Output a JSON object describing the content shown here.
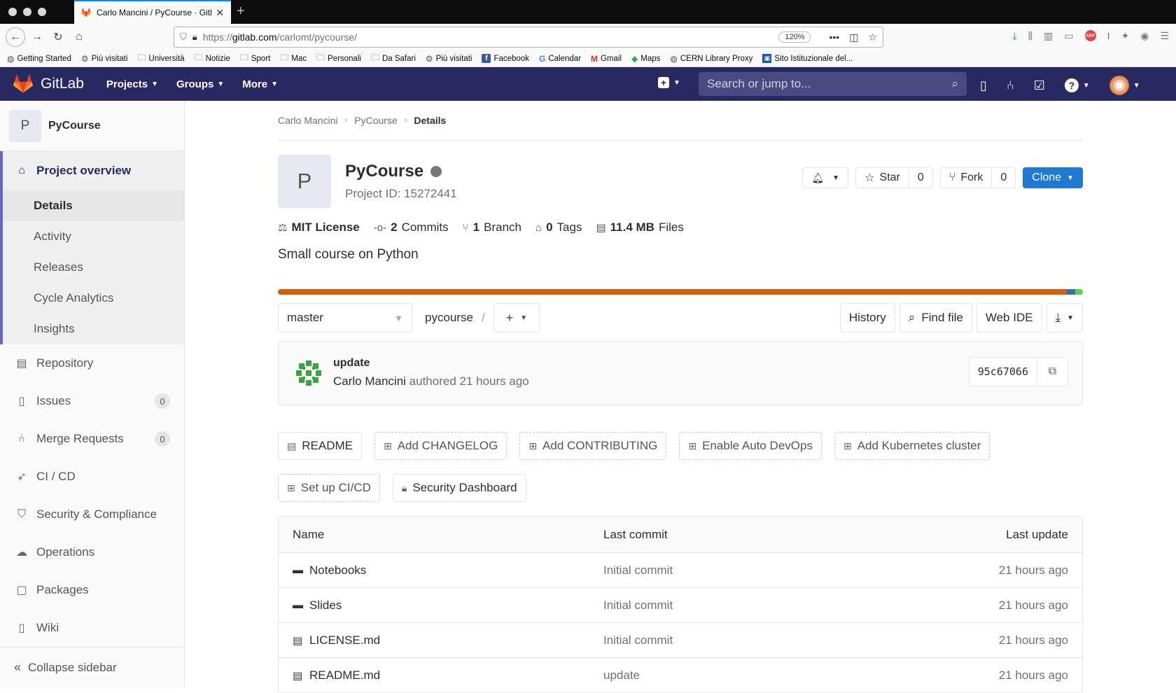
{
  "browser": {
    "tab_title": "Carlo Mancini / PyCourse · GitLab",
    "url_prefix": "https://",
    "url_host": "gitlab.com",
    "url_path": "/carlomt/pycourse/",
    "zoom": "120%",
    "bookmarks": [
      {
        "label": "Getting Started",
        "icon": "globe-icon"
      },
      {
        "label": "Più visitati",
        "icon": "gear-icon"
      },
      {
        "label": "Università",
        "icon": "folder-icon"
      },
      {
        "label": "Notizie",
        "icon": "folder-icon"
      },
      {
        "label": "Sport",
        "icon": "folder-icon"
      },
      {
        "label": "Mac",
        "icon": "folder-icon"
      },
      {
        "label": "Personali",
        "icon": "folder-icon"
      },
      {
        "label": "Da Safari",
        "icon": "folder-icon"
      },
      {
        "label": "Più visitati",
        "icon": "gear-icon"
      },
      {
        "label": "Facebook",
        "icon": "facebook-icon"
      },
      {
        "label": "Calendar",
        "icon": "google-icon"
      },
      {
        "label": "Gmail",
        "icon": "gmail-icon"
      },
      {
        "label": "Maps",
        "icon": "maps-icon"
      },
      {
        "label": "CERN Library Proxy",
        "icon": "globe-icon"
      },
      {
        "label": "Sito Istituzionale del...",
        "icon": "site-icon"
      }
    ]
  },
  "header": {
    "brand": "GitLab",
    "nav": [
      "Projects",
      "Groups",
      "More"
    ],
    "search_placeholder": "Search or jump to..."
  },
  "sidebar": {
    "project_initial": "P",
    "project_name": "PyCourse",
    "overview_label": "Project overview",
    "overview_sub": [
      "Details",
      "Activity",
      "Releases",
      "Cycle Analytics",
      "Insights"
    ],
    "items": [
      {
        "label": "Repository",
        "icon": "doc-icon"
      },
      {
        "label": "Issues",
        "icon": "issues-icon",
        "badge": "0"
      },
      {
        "label": "Merge Requests",
        "icon": "merge-request-icon",
        "badge": "0"
      },
      {
        "label": "CI / CD",
        "icon": "rocket-icon"
      },
      {
        "label": "Security & Compliance",
        "icon": "shield-icon"
      },
      {
        "label": "Operations",
        "icon": "cloud-gear-icon"
      },
      {
        "label": "Packages",
        "icon": "package-icon"
      },
      {
        "label": "Wiki",
        "icon": "book-icon"
      }
    ],
    "collapse_label": "Collapse sidebar"
  },
  "breadcrumb": [
    "Carlo Mancini",
    "PyCourse",
    "Details"
  ],
  "project": {
    "initial": "P",
    "name": "PyCourse",
    "id_text": "Project ID: 15272441",
    "star_label": "Star",
    "star_count": "0",
    "fork_label": "Fork",
    "fork_count": "0",
    "clone_label": "Clone",
    "stats": [
      {
        "icon": "scale-icon",
        "bold": "MIT License",
        "rest": ""
      },
      {
        "icon": "commit-icon",
        "bold": "2",
        "rest": "Commits"
      },
      {
        "icon": "branch-icon",
        "bold": "1",
        "rest": "Branch"
      },
      {
        "icon": "tag-icon",
        "bold": "0",
        "rest": "Tags"
      },
      {
        "icon": "file-icon",
        "bold": "11.4 MB",
        "rest": "Files"
      }
    ],
    "description": "Small course on Python",
    "languages": [
      {
        "share": 98.0,
        "color": "#DA5B0B"
      },
      {
        "share": 1.0,
        "color": "#3572A5"
      },
      {
        "share": 1.0,
        "color": "#5BD14A"
      }
    ]
  },
  "tree": {
    "branch": "master",
    "path": "pycourse",
    "path_sep": "/",
    "buttons": {
      "history": "History",
      "find_file": "Find file",
      "web_ide": "Web IDE"
    }
  },
  "last_commit": {
    "title": "update",
    "author": "Carlo Mancini",
    "meta": "authored 21 hours ago",
    "sha": "95c67066"
  },
  "quick_actions": {
    "row1": [
      {
        "label": "README",
        "style": "solid",
        "icon": "doc-icon"
      },
      {
        "label": "Add CHANGELOG",
        "style": "dashed",
        "icon": "plus-square-icon"
      },
      {
        "label": "Add CONTRIBUTING",
        "style": "dashed",
        "icon": "plus-square-icon"
      },
      {
        "label": "Enable Auto DevOps",
        "style": "dashed",
        "icon": "plus-square-icon"
      },
      {
        "label": "Add Kubernetes cluster",
        "style": "dashed",
        "icon": "plus-square-icon"
      }
    ],
    "row2": [
      {
        "label": "Set up CI/CD",
        "style": "dashed",
        "icon": "plus-square-icon"
      },
      {
        "label": "Security Dashboard",
        "style": "solid",
        "icon": "lock-icon"
      }
    ]
  },
  "files": {
    "headers": [
      "Name",
      "Last commit",
      "Last update"
    ],
    "rows": [
      {
        "name": "Notebooks",
        "type": "folder",
        "commit": "Initial commit",
        "updated": "21 hours ago"
      },
      {
        "name": "Slides",
        "type": "folder",
        "commit": "Initial commit",
        "updated": "21 hours ago"
      },
      {
        "name": "LICENSE.md",
        "type": "file",
        "commit": "Initial commit",
        "updated": "21 hours ago"
      },
      {
        "name": "README.md",
        "type": "file",
        "commit": "update",
        "updated": "21 hours ago"
      }
    ]
  }
}
